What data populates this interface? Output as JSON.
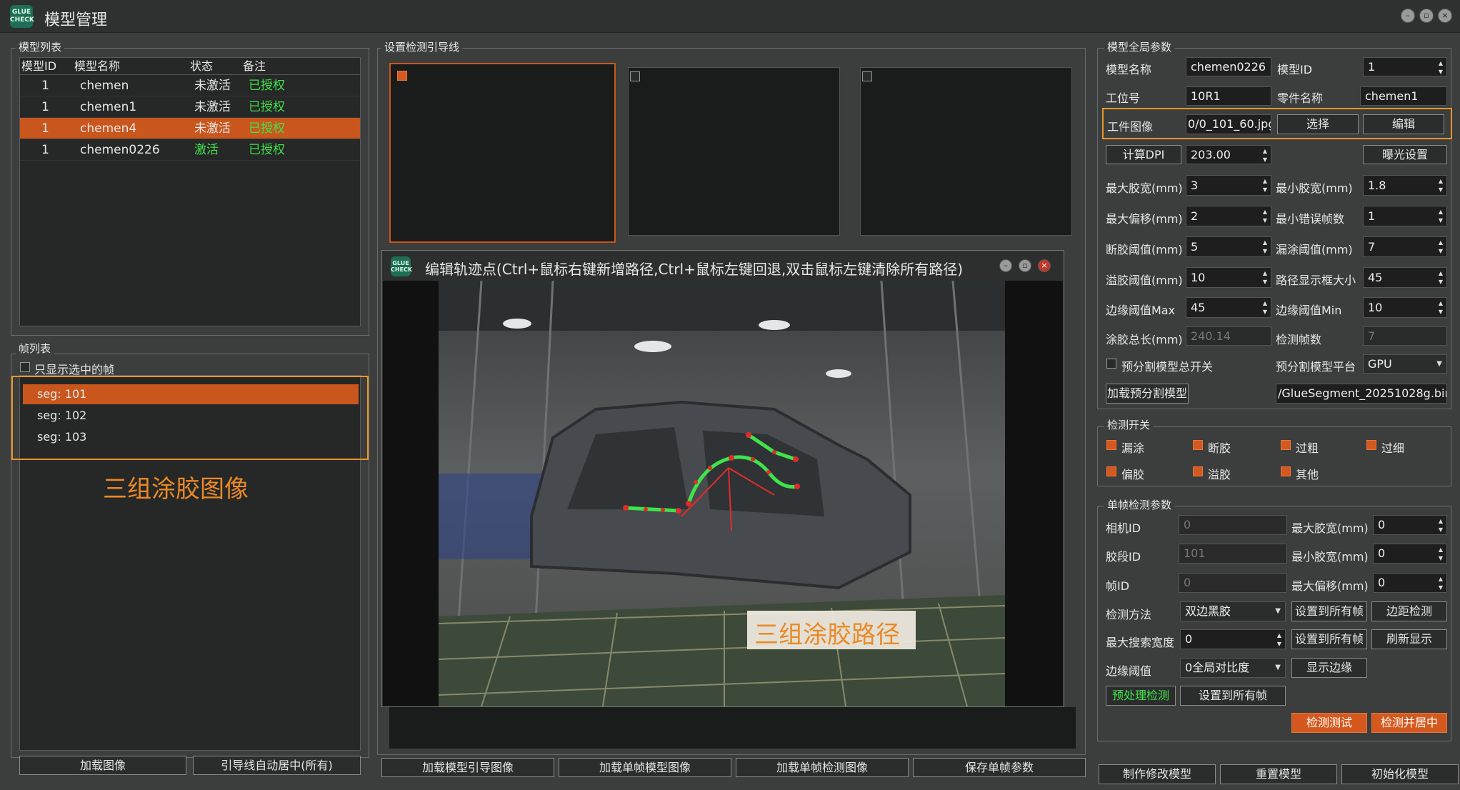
{
  "window": {
    "title": "模型管理",
    "logo_text": "GLUE CHECK"
  },
  "model_list": {
    "title": "模型列表",
    "columns": [
      "模型ID",
      "模型名称",
      "状态",
      "备注"
    ],
    "rows": [
      {
        "id": "1",
        "name": "chemen",
        "status": "未激活",
        "note": "已授权"
      },
      {
        "id": "1",
        "name": "chemen1",
        "status": "未激活",
        "note": "已授权"
      },
      {
        "id": "1",
        "name": "chemen4",
        "status": "未激活",
        "note": "已授权"
      },
      {
        "id": "1",
        "name": "chemen0226",
        "status": "激活",
        "note": "已授权"
      }
    ]
  },
  "frame_list": {
    "title": "帧列表",
    "checkbox_label": "只显示选中的帧",
    "items": [
      "seg: 101",
      "seg: 102",
      "seg: 103"
    ],
    "annotation": "三组涂胶图像"
  },
  "left_buttons": {
    "load_image": "加载图像",
    "auto_center": "引导线自动居中(所有)"
  },
  "guide": {
    "title": "设置检测引导线"
  },
  "editor": {
    "title": "编辑轨迹点(Ctrl+鼠标右键新增路径,Ctrl+鼠标左键回退,双击鼠标左键清除所有路径)",
    "annotation": "三组涂胶路径"
  },
  "bottom_buttons": {
    "load_guide": "加载模型引导图像",
    "load_single_model": "加载单帧模型图像",
    "load_single_detect": "加载单帧检测图像",
    "save_single": "保存单帧参数"
  },
  "global": {
    "title": "模型全局参数",
    "model_name_label": "模型名称",
    "model_name": "chemen0226",
    "model_id_label": "模型ID",
    "model_id": "1",
    "station_label": "工位号",
    "station": "10R1",
    "part_label": "零件名称",
    "part": "chemen1",
    "work_image_label": "工件图像",
    "work_image": "0/0_101_60.jpg",
    "choose": "选择",
    "edit": "编辑",
    "calc_dpi": "计算DPI",
    "dpi": "203.00",
    "exposure": "曝光设置",
    "max_width_label": "最大胶宽(mm)",
    "max_width": "3",
    "min_width_label": "最小胶宽(mm)",
    "min_width": "1.8",
    "max_offset_label": "最大偏移(mm)",
    "max_offset": "2",
    "min_err_label": "最小错误帧数",
    "min_err": "1",
    "break_label": "断胶阈值(mm)",
    "break": "5",
    "leak_label": "漏涂阈值(mm)",
    "leak": "7",
    "overflow_label": "溢胶阈值(mm)",
    "overflow": "10",
    "path_box_label": "路径显示框大小",
    "path_box": "45",
    "edge_max_label": "边缘阈值Max",
    "edge_max": "45",
    "edge_min_label": "边缘阈值Min",
    "edge_min": "10",
    "total_len_label": "涂胶总长(mm)",
    "total_len": "240.14",
    "detect_frames_label": "检测帧数",
    "detect_frames": "7",
    "preseg_switch_label": "预分割模型总开关",
    "preseg_platform_label": "预分割模型平台",
    "preseg_platform": "GPU",
    "load_preseg": "加载预分割模型",
    "preseg_file": "/GlueSegment_20251028g.bin"
  },
  "switches": {
    "title": "检测开关",
    "items": [
      "漏涂",
      "断胶",
      "过粗",
      "过细",
      "偏胶",
      "溢胶",
      "其他"
    ]
  },
  "single": {
    "title": "单帧检测参数",
    "camera_label": "相机ID",
    "camera": "0",
    "seg_label": "胶段ID",
    "seg": "101",
    "frame_label": "帧ID",
    "frame": "0",
    "max_w_label": "最大胶宽(mm)",
    "max_w": "0",
    "min_w_label": "最小胶宽(mm)",
    "min_w": "0",
    "max_off_label": "最大偏移(mm)",
    "max_off": "0",
    "method_label": "检测方法",
    "method": "双边黑胶",
    "set_all": "设置到所有帧",
    "edge_detect": "边距检测",
    "search_label": "最大搜索宽度",
    "search": "0",
    "refresh": "刷新显示",
    "edge_th_label": "边缘阈值",
    "edge_th": "0全局对比度",
    "show_edge": "显示边缘",
    "preprocess": "预处理检测",
    "detect_test": "检测测试",
    "detect_center": "检测并居中"
  },
  "footer": {
    "make": "制作修改模型",
    "reset": "重置模型",
    "init": "初始化模型"
  }
}
